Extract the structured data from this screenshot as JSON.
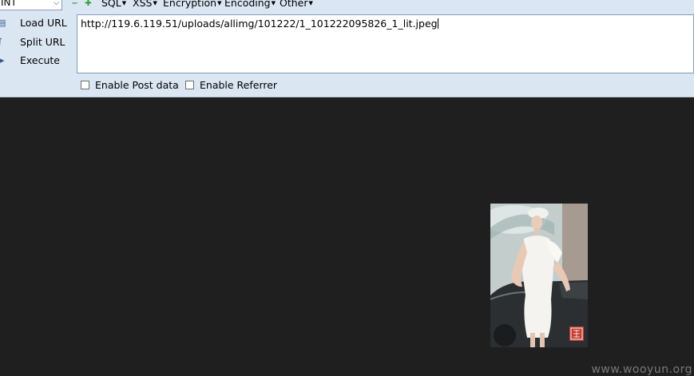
{
  "toolbar": {
    "select_value": "INT",
    "menus": [
      {
        "label": "SQL"
      },
      {
        "label": "XSS"
      },
      {
        "label": "Encryption"
      },
      {
        "label": "Encoding"
      },
      {
        "label": "Other"
      }
    ],
    "icons": [
      "minus-icon",
      "plus-icon"
    ]
  },
  "actions": {
    "load_url_label": "Load URL",
    "split_url_label": "Split URL",
    "execute_label": "Execute"
  },
  "url_input": {
    "value": "http://119.6.119.51/uploads/allimg/101222/1_101222095826_1_lit.jpeg"
  },
  "options": {
    "post_data_label": "Enable Post data",
    "post_data_checked": false,
    "referrer_label": "Enable Referrer",
    "referrer_checked": false
  },
  "content": {
    "background_color": "#1f1f1f",
    "image_subject": "photo of woman in white dress standing by a car"
  },
  "footer": {
    "watermark": "www.wooyun.org"
  }
}
